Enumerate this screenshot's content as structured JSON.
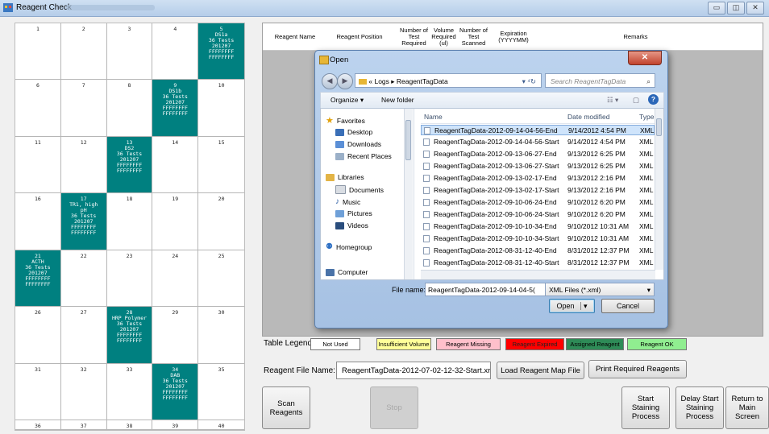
{
  "window": {
    "title": "Reagent Check",
    "buttons": [
      "minimize",
      "maximize",
      "close"
    ]
  },
  "tray": {
    "cells": [
      {
        "num": "1"
      },
      {
        "num": "2"
      },
      {
        "num": "3"
      },
      {
        "num": "4"
      },
      {
        "num": "5",
        "lines": [
          "DS1a",
          "36 Tests",
          "201207",
          "FFFFFFFF",
          "FFFFFFFF"
        ],
        "assigned": true
      },
      {
        "num": "6"
      },
      {
        "num": "7"
      },
      {
        "num": "8"
      },
      {
        "num": "9",
        "lines": [
          "DS1b",
          "36 Tests",
          "201207",
          "FFFFFFFF",
          "FFFFFFFF"
        ],
        "assigned": true
      },
      {
        "num": "10"
      },
      {
        "num": "11"
      },
      {
        "num": "12"
      },
      {
        "num": "13",
        "lines": [
          "DS2",
          "36 Tests",
          "201207",
          "FFFFFFFF",
          "FFFFFFFF"
        ],
        "assigned": true
      },
      {
        "num": "14"
      },
      {
        "num": "15"
      },
      {
        "num": "16"
      },
      {
        "num": "17",
        "lines": [
          "TR1, high",
          "pH",
          "36 Tests",
          "201207",
          "FFFFFFFF",
          "FFFFFFFF"
        ],
        "assigned": true
      },
      {
        "num": "18"
      },
      {
        "num": "19"
      },
      {
        "num": "20"
      },
      {
        "num": "21",
        "lines": [
          "ACTH",
          "36 Tests",
          "201207",
          "FFFFFFFF",
          "FFFFFFFF"
        ],
        "assigned": true
      },
      {
        "num": "22"
      },
      {
        "num": "23"
      },
      {
        "num": "24"
      },
      {
        "num": "25"
      },
      {
        "num": "26"
      },
      {
        "num": "27"
      },
      {
        "num": "28",
        "lines": [
          "HRP Polymer",
          "36 Tests",
          "201207",
          "FFFFFFFF",
          "FFFFFFFF"
        ],
        "assigned": true
      },
      {
        "num": "29"
      },
      {
        "num": "30"
      },
      {
        "num": "31"
      },
      {
        "num": "32"
      },
      {
        "num": "33"
      },
      {
        "num": "34",
        "lines": [
          "DAB",
          "36 Tests",
          "201207",
          "FFFFFFFF",
          "FFFFFFFF"
        ],
        "assigned": true
      },
      {
        "num": "35"
      },
      {
        "num": "36"
      },
      {
        "num": "37"
      },
      {
        "num": "38"
      },
      {
        "num": "39"
      },
      {
        "num": "40"
      }
    ]
  },
  "table": {
    "headers": {
      "name": "Reagent Name",
      "position": "Reagent Position",
      "tests_required": "Number of Test Required",
      "volume_required": "Volume Required (ul)",
      "tests_scanned": "Number of Test Scanned",
      "expiration": "Expiration (YYYYMM)",
      "remarks": "Remarks"
    }
  },
  "legend": {
    "label": "Table Legend:",
    "items": [
      {
        "text": "Not Used",
        "bg": "#ffffff"
      },
      {
        "text": "Insufficient Volume",
        "bg": "#ffff99"
      },
      {
        "text": "Reagent Missing",
        "bg": "#ffc0cb"
      },
      {
        "text": "Reagent Expired",
        "bg": "#ff0000"
      },
      {
        "text": "Assigned Reagent",
        "bg": "#2e8b57"
      },
      {
        "text": "Reagent OK",
        "bg": "#90ee90"
      }
    ]
  },
  "file": {
    "label": "Reagent File Name:",
    "value": "ReagentTagData-2012-07-02-12-32-Start.xr",
    "load_button": "Load Reagent Map File",
    "print_button": "Print Required Reagents"
  },
  "actions": {
    "scan": "Scan Reagents",
    "stop": "Stop",
    "start": "Start Staining Process",
    "delay": "Delay Start Staining Process",
    "return": "Return to Main Screen"
  },
  "dialog": {
    "title": "Open",
    "path": "« Logs ▸ ReagentTagData",
    "search_placeholder": "Search ReagentTagData",
    "organize": "Organize ▾",
    "new_folder": "New folder",
    "nav": {
      "favorites": "Favorites",
      "desktop": "Desktop",
      "downloads": "Downloads",
      "recent": "Recent Places",
      "libraries": "Libraries",
      "documents": "Documents",
      "music": "Music",
      "pictures": "Pictures",
      "videos": "Videos",
      "homegroup": "Homegroup",
      "computer": "Computer"
    },
    "columns": {
      "name": "Name",
      "date": "Date modified",
      "type": "Type"
    },
    "files": [
      {
        "name": "ReagentTagData-2012-09-14-04-56-End",
        "date": "9/14/2012 4:54 PM",
        "type": "XML D"
      },
      {
        "name": "ReagentTagData-2012-09-14-04-56-Start",
        "date": "9/14/2012 4:54 PM",
        "type": "XML D"
      },
      {
        "name": "ReagentTagData-2012-09-13-06-27-End",
        "date": "9/13/2012 6:25 PM",
        "type": "XML D"
      },
      {
        "name": "ReagentTagData-2012-09-13-06-27-Start",
        "date": "9/13/2012 6:25 PM",
        "type": "XML D"
      },
      {
        "name": "ReagentTagData-2012-09-13-02-17-End",
        "date": "9/13/2012 2:16 PM",
        "type": "XML D"
      },
      {
        "name": "ReagentTagData-2012-09-13-02-17-Start",
        "date": "9/13/2012 2:16 PM",
        "type": "XML D"
      },
      {
        "name": "ReagentTagData-2012-09-10-06-24-End",
        "date": "9/10/2012 6:20 PM",
        "type": "XML D"
      },
      {
        "name": "ReagentTagData-2012-09-10-06-24-Start",
        "date": "9/10/2012 6:20 PM",
        "type": "XML D"
      },
      {
        "name": "ReagentTagData-2012-09-10-10-34-End",
        "date": "9/10/2012 10:31 AM",
        "type": "XML D"
      },
      {
        "name": "ReagentTagData-2012-09-10-10-34-Start",
        "date": "9/10/2012 10:31 AM",
        "type": "XML D"
      },
      {
        "name": "ReagentTagData-2012-08-31-12-40-End",
        "date": "8/31/2012 12:37 PM",
        "type": "XML D"
      },
      {
        "name": "ReagentTagData-2012-08-31-12-40-Start",
        "date": "8/31/2012 12:37 PM",
        "type": "XML D"
      }
    ],
    "filename_label": "File name:",
    "filename_value": "ReagentTagData-2012-09-14-04-5(",
    "filter": "XML Files (*.xml)",
    "open": "Open",
    "cancel": "Cancel"
  }
}
